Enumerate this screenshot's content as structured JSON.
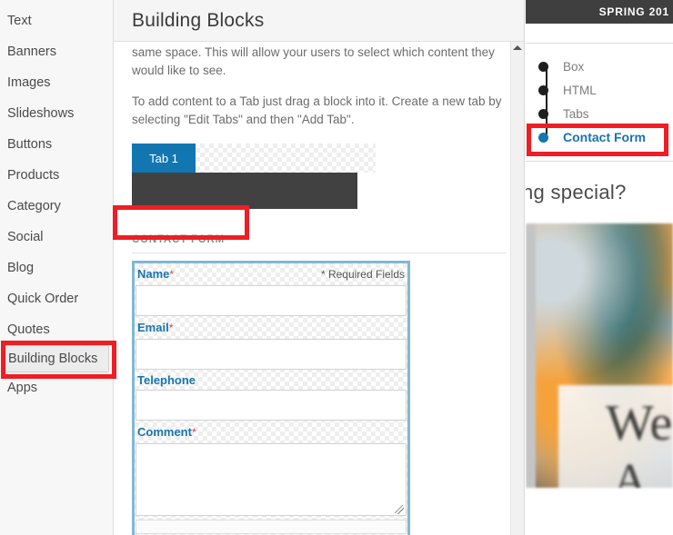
{
  "sidebar": {
    "items": [
      {
        "label": "Text",
        "selected": false
      },
      {
        "label": "Banners",
        "selected": false
      },
      {
        "label": "Images",
        "selected": false
      },
      {
        "label": "Slideshows",
        "selected": false
      },
      {
        "label": "Buttons",
        "selected": false
      },
      {
        "label": "Products",
        "selected": false
      },
      {
        "label": "Category",
        "selected": false
      },
      {
        "label": "Social",
        "selected": false
      },
      {
        "label": "Blog",
        "selected": false
      },
      {
        "label": "Quick Order",
        "selected": false
      },
      {
        "label": "Quotes",
        "selected": false
      },
      {
        "label": "Building Blocks",
        "selected": true
      },
      {
        "label": "Apps",
        "selected": false
      }
    ]
  },
  "panel": {
    "title": "Building Blocks",
    "paragraph_1": "same space. This will allow your users to select which content they would like to see.",
    "paragraph_2": "To add content to a Tab just drag a block into it. Create a new tab by selecting \"Edit Tabs\" and then \"Add Tab\".",
    "tab_preview": {
      "tab_label": "Tab 1"
    },
    "contact_form_heading": "CONTACT FORM"
  },
  "contact_form": {
    "required_note": "* Required Fields",
    "fields": [
      {
        "label": "Name",
        "required": true,
        "type": "input",
        "value": "",
        "placeholder": ""
      },
      {
        "label": "Email",
        "required": true,
        "type": "input",
        "value": "",
        "placeholder": ""
      },
      {
        "label": "Telephone",
        "required": false,
        "type": "input",
        "value": "",
        "placeholder": ""
      },
      {
        "label": "Comment",
        "required": true,
        "type": "textarea",
        "value": "",
        "placeholder": ""
      }
    ],
    "star": "*"
  },
  "preview": {
    "topbar_text": "SPRING 201",
    "hero_text": "ng special?",
    "hero_word_1": "We",
    "hero_word_2": "A",
    "block_list": [
      {
        "label": "Box",
        "active": false
      },
      {
        "label": "HTML",
        "active": false
      },
      {
        "label": "Tabs",
        "active": false
      },
      {
        "label": "Contact Form",
        "active": true
      }
    ]
  },
  "colors": {
    "accent_blue": "#1277b0",
    "label_blue": "#1a74ad",
    "annotation_red": "#ef1d24",
    "required_star": "#e23c3c",
    "dark_block": "#414141",
    "topbar_dark": "#3f3f3f"
  }
}
